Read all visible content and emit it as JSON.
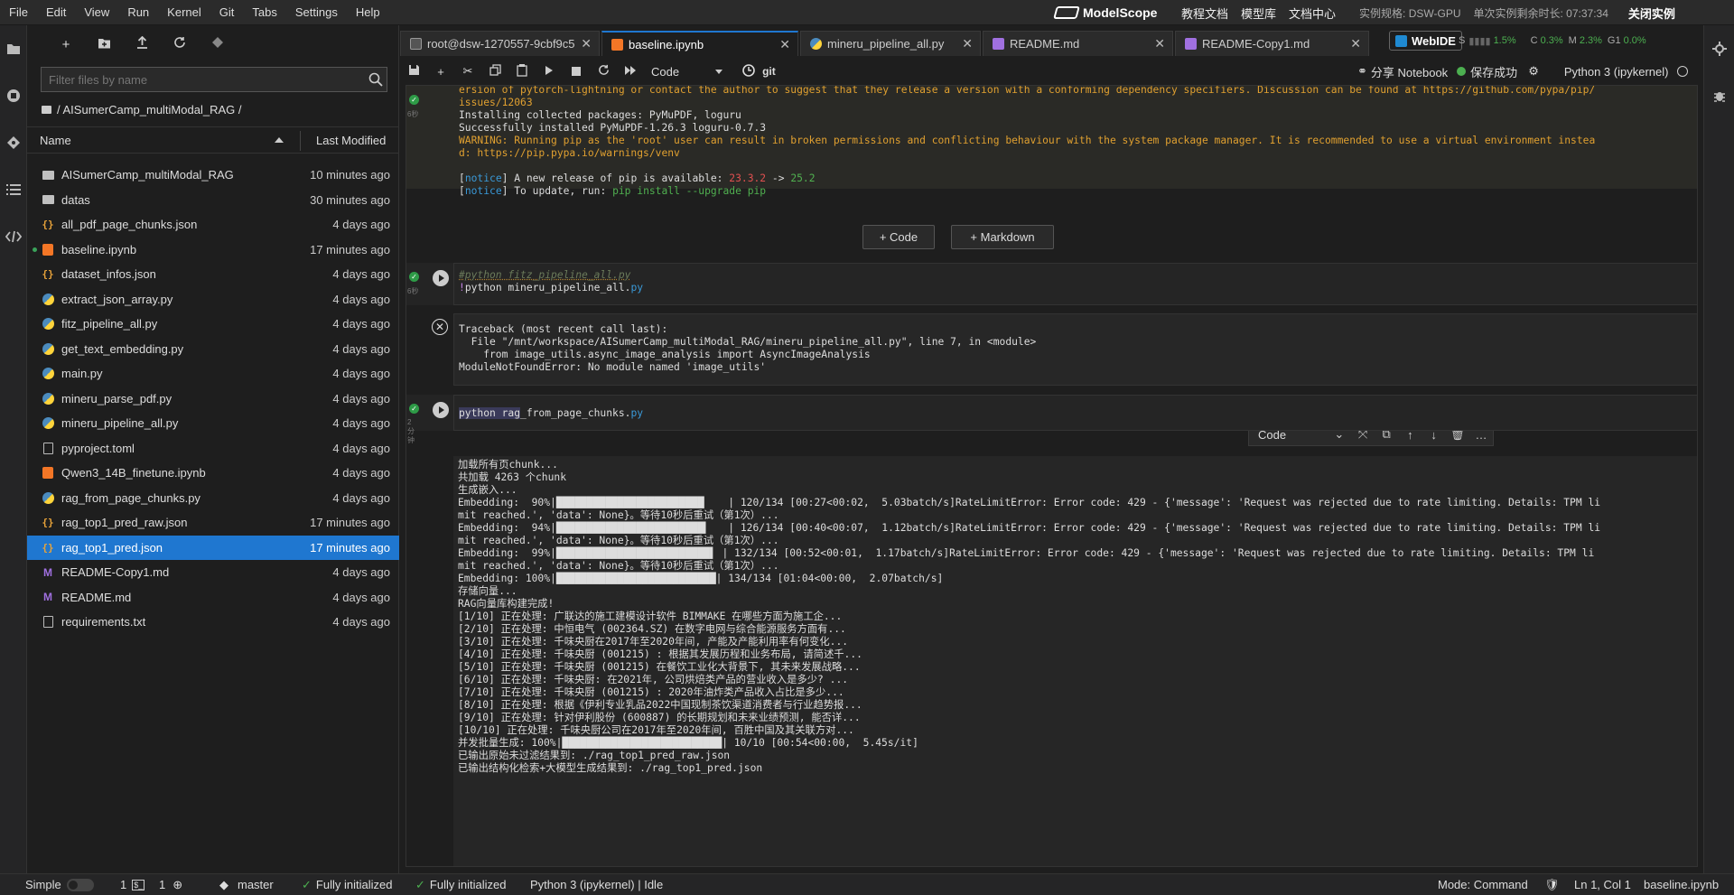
{
  "menu": [
    "File",
    "Edit",
    "View",
    "Run",
    "Kernel",
    "Git",
    "Tabs",
    "Settings",
    "Help"
  ],
  "brand": {
    "name": "ModelScope"
  },
  "top_links": [
    "教程文档",
    "模型库",
    "文档中心"
  ],
  "instance": {
    "spec": "实例规格: DSW-GPU",
    "remaining": "单次实例剩余时长: 07:37:34",
    "close": "关闭实例"
  },
  "filebrowser": {
    "filter_placeholder": "Filter files by name",
    "breadcrumb": "/ AISumerCamp_multiModal_RAG /",
    "col_name": "Name",
    "col_modified": "Last Modified",
    "files": [
      {
        "name": "AISumerCamp_multiModal_RAG",
        "type": "folder",
        "modified": "10 minutes ago"
      },
      {
        "name": "datas",
        "type": "folder",
        "modified": "30 minutes ago"
      },
      {
        "name": "all_pdf_page_chunks.json",
        "type": "json",
        "modified": "4 days ago"
      },
      {
        "name": "baseline.ipynb",
        "type": "notebook",
        "modified": "17 minutes ago",
        "running": true
      },
      {
        "name": "dataset_infos.json",
        "type": "json",
        "modified": "4 days ago"
      },
      {
        "name": "extract_json_array.py",
        "type": "python",
        "modified": "4 days ago"
      },
      {
        "name": "fitz_pipeline_all.py",
        "type": "python",
        "modified": "4 days ago"
      },
      {
        "name": "get_text_embedding.py",
        "type": "python",
        "modified": "4 days ago"
      },
      {
        "name": "main.py",
        "type": "python",
        "modified": "4 days ago"
      },
      {
        "name": "mineru_parse_pdf.py",
        "type": "python",
        "modified": "4 days ago"
      },
      {
        "name": "mineru_pipeline_all.py",
        "type": "python",
        "modified": "4 days ago"
      },
      {
        "name": "pyproject.toml",
        "type": "file",
        "modified": "4 days ago"
      },
      {
        "name": "Qwen3_14B_finetune.ipynb",
        "type": "notebook",
        "modified": "4 days ago"
      },
      {
        "name": "rag_from_page_chunks.py",
        "type": "python",
        "modified": "4 days ago"
      },
      {
        "name": "rag_top1_pred_raw.json",
        "type": "json",
        "modified": "17 minutes ago"
      },
      {
        "name": "rag_top1_pred.json",
        "type": "json",
        "modified": "17 minutes ago",
        "selected": true
      },
      {
        "name": "README-Copy1.md",
        "type": "markdown",
        "modified": "4 days ago"
      },
      {
        "name": "README.md",
        "type": "markdown",
        "modified": "4 days ago"
      },
      {
        "name": "requirements.txt",
        "type": "file",
        "modified": "4 days ago"
      }
    ]
  },
  "tabs": [
    {
      "label": "root@dsw-1270557-9cbf9c5",
      "type": "terminal"
    },
    {
      "label": "baseline.ipynb",
      "type": "notebook",
      "active": true
    },
    {
      "label": "mineru_pipeline_all.py",
      "type": "python"
    },
    {
      "label": "README.md",
      "type": "markdown"
    },
    {
      "label": "README-Copy1.md",
      "type": "markdown"
    }
  ],
  "webide": "WebIDE",
  "resources": {
    "s_label": "S",
    "s_value": "1.5%",
    "c_label": "C",
    "c_value": "0.3%",
    "m_label": "M",
    "m_value": "2.3%",
    "g_label": "G1",
    "g_value": "0.0%"
  },
  "notebook": {
    "cell_type": "Code",
    "git": "git",
    "share": "分享 Notebook",
    "saved": "保存成功",
    "kernel": "Python 3 (ipykernel)",
    "add_code": "+ Code",
    "add_markdown": "+ Markdown",
    "out1_lines": [
      {
        "t": "ersion of pytorch-lightning or contact the author to suggest that they release a version with a conforming dependency specifiers. Discussion can be found at https://github.com/pypa/pip/",
        "c": "warn"
      },
      {
        "t": "issues/12063",
        "c": "warn"
      },
      {
        "t": "Installing collected packages: PyMuPDF, loguru",
        "c": "norm"
      },
      {
        "t": "Successfully installed PyMuPDF-1.26.3 loguru-0.7.3",
        "c": "norm"
      },
      {
        "t": "WARNING: Running pip as the 'root' user can result in broken permissions and conflicting behaviour with the system package manager. It is recommended to use a virtual environment instea",
        "c": "warn"
      },
      {
        "t": "d: https://pip.pypa.io/warnings/venv",
        "c": "warn"
      },
      {
        "t": "",
        "c": "norm"
      }
    ],
    "notice1": {
      "open": "[",
      "tag": "notice",
      "close": "]",
      "text": " A new release of pip is available: ",
      "old": "23.3.2",
      "arrow": " -> ",
      "new": "25.2"
    },
    "notice2": {
      "open": "[",
      "tag": "notice",
      "close": "]",
      "text": " To update, run: ",
      "cmd": "pip install --upgrade pip"
    },
    "cell2_exec": "6秒",
    "cell2_line1": "#python fitz_pipeline_all.py",
    "cell2_bang": "!",
    "cell2_cmd": "python mineru_pipeline_all.",
    "cell2_ext": "py",
    "error_lines": [
      "Traceback (most recent call last):",
      "  File \"/mnt/workspace/AISumerCamp_multiModal_RAG/mineru_pipeline_all.py\", line 7, in <module>",
      "    from image_utils.async_image_analysis import AsyncImageAnalysis",
      "ModuleNotFoundError: No module named 'image_utils'"
    ],
    "cell3_exec": "2分钟",
    "cell3_cmd_a": "python rag",
    "cell3_cmd_b": "_from_page_chunks.",
    "cell3_ext": "py",
    "cell3_output": [
      "加载所有页chunk...",
      "共加载 4263 个chunk",
      "生成嵌入...",
      "Embedding:  90%|████████████████████████▏   | 120/134 [00:27<00:02,  5.03batch/s]RateLimitError: Error code: 429 - {'message': 'Request was rejected due to rate limiting. Details: TPM li",
      "mit reached.', 'data': None}。等待10秒后重试（第1次）...",
      "Embedding:  94%|████████████████████████▍   | 126/134 [00:40<00:07,  1.12batch/s]RateLimitError: Error code: 429 - {'message': 'Request was rejected due to rate limiting. Details: TPM li",
      "mit reached.', 'data': None}。等待10秒后重试（第1次）...",
      "Embedding:  99%|█████████████████████████▌ | 132/134 [00:52<00:01,  1.17batch/s]RateLimitError: Error code: 429 - {'message': 'Request was rejected due to rate limiting. Details: TPM li",
      "mit reached.', 'data': None}。等待10秒后重试（第1次）...",
      "Embedding: 100%|██████████████████████████| 134/134 [01:04<00:00,  2.07batch/s]",
      "存储向量...",
      "RAG向量库构建完成!",
      "[1/10] 正在处理: 广联达的施工建模设计软件 BIMMAKE 在哪些方面为施工企...",
      "[2/10] 正在处理: 中恒电气 (002364.SZ) 在数字电网与综合能源服务方面有...",
      "[3/10] 正在处理: 千味央厨在2017年至2020年间, 产能及产能利用率有何变化...",
      "[4/10] 正在处理: 千味央厨 (001215) : 根据其发展历程和业务布局, 请简述千...",
      "[5/10] 正在处理: 千味央厨 (001215) 在餐饮工业化大背景下, 其未来发展战略...",
      "[6/10] 正在处理: 千味央厨: 在2021年, 公司烘焙类产品的营业收入是多少? ...",
      "[7/10] 正在处理: 千味央厨 (001215) : 2020年油炸类产品收入占比是多少...",
      "[8/10] 正在处理: 根据《伊利专业乳品2022中国现制茶饮渠道消费者与行业趋势报...",
      "[9/10] 正在处理: 针对伊利股份 (600887) 的长期规划和未来业绩预测, 能否详...",
      "[10/10] 正在处理: 千味央厨公司在2017年至2020年间, 百胜中国及其关联方对...",
      "并发批量生成: 100%|██████████████████████████| 10/10 [00:54<00:00,  5.45s/it]",
      "已输出原始未过滤结果到: ./rag_top1_pred_raw.json",
      "已输出结构化检索+大模型生成结果到: ./rag_top1_pred.json"
    ],
    "cell_toolbar_type": "Code"
  },
  "status": {
    "mode_label": "Simple",
    "count1": "1",
    "count2": "1",
    "branch": "master",
    "init1": "Fully initialized",
    "init2": "Fully initialized",
    "kernel_status": "Python 3 (ipykernel) | Idle",
    "mode": "Mode: Command",
    "position": "Ln 1, Col 1",
    "filename": "baseline.ipynb"
  },
  "colors": {
    "accent": "#1f77d0",
    "success": "#2e9b47",
    "warning": "#e0a030"
  }
}
